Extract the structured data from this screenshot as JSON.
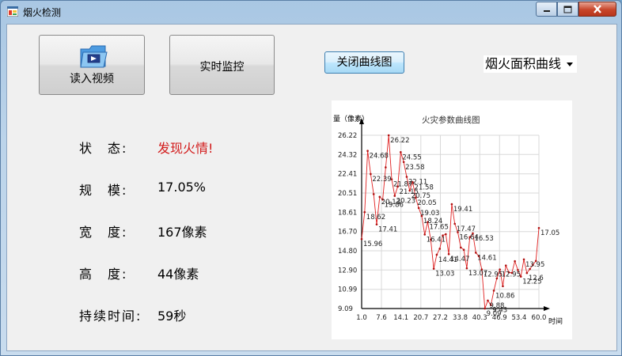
{
  "window": {
    "title": "烟火检测",
    "controls": [
      "minimize",
      "maximize",
      "close"
    ]
  },
  "buttons": {
    "read_video": "读入视频",
    "live_monitor": "实时监控",
    "close_chart": "关闭曲线图"
  },
  "combo": {
    "selected": "烟火面积曲线"
  },
  "info": [
    {
      "label": "状　态:",
      "value": "发现火情!",
      "alert": true
    },
    {
      "label": "规　模:",
      "value": "17.05%"
    },
    {
      "label": "宽　度:",
      "value": "167像素"
    },
    {
      "label": "高　度:",
      "value": "44像素"
    },
    {
      "label": "持续时间:",
      "value": "59秒"
    }
  ],
  "colors": {
    "alert": "#d21a1a",
    "series": "#e02020",
    "grid": "#d8d8d8"
  },
  "chart_data": {
    "type": "line",
    "title": "火灾参数曲线图",
    "ylabel": "量（像素）",
    "xlabel": "时间",
    "y_ticks": [
      9.09,
      10.99,
      12.9,
      14.8,
      16.7,
      18.61,
      20.51,
      22.41,
      24.32,
      26.22
    ],
    "x_ticks": [
      1.0,
      7.6,
      14.1,
      20.7,
      27.2,
      33.8,
      40.3,
      46.9,
      53.4,
      60.0
    ],
    "xlim": [
      1.0,
      60.0
    ],
    "ylim": [
      9.09,
      26.22
    ],
    "grid": true,
    "series": [
      {
        "x": [
          1,
          2,
          3,
          4,
          5,
          6,
          7,
          8,
          9,
          10,
          11,
          12,
          13,
          14,
          15,
          16,
          17,
          18,
          19,
          20,
          21,
          22,
          23,
          24,
          25,
          26,
          27,
          28,
          29,
          30,
          31,
          32,
          33,
          34,
          35,
          36,
          37,
          38,
          39,
          40,
          41,
          42,
          43,
          44,
          45,
          46,
          47,
          48,
          49,
          50,
          51,
          52,
          53,
          54,
          55,
          56,
          57,
          58,
          59,
          60
        ],
        "values": [
          15.96,
          18.62,
          24.68,
          22.39,
          20.4,
          17.41,
          20.13,
          19.86,
          23.05,
          26.22,
          21.87,
          20.23,
          21.15,
          24.55,
          23.58,
          22.11,
          20.75,
          21.58,
          20.05,
          19.03,
          18.24,
          16.41,
          17.65,
          15.9,
          13.03,
          14.41,
          15.0,
          16.31,
          16.44,
          14.47,
          19.41,
          17.47,
          16.64,
          15.12,
          14.9,
          13.07,
          16.15,
          16.53,
          14.61,
          14.27,
          12.95,
          9.09,
          9.88,
          9.43,
          10.86,
          12.07,
          12.95,
          11.3,
          13.34,
          12.67,
          12.61,
          13.77,
          12.9,
          12.25,
          13.95,
          12.6,
          13.0,
          13.4,
          13.8,
          17.05
        ]
      }
    ],
    "data_labels": [
      {
        "x": 1,
        "text": "15.96"
      },
      {
        "x": 2,
        "text": "18.62"
      },
      {
        "x": 3,
        "text": "24.68"
      },
      {
        "x": 4,
        "text": "22.39"
      },
      {
        "x": 6,
        "text": "17.41"
      },
      {
        "x": 7,
        "text": "20.13"
      },
      {
        "x": 8,
        "text": "19.86"
      },
      {
        "x": 10,
        "text": "26.22"
      },
      {
        "x": 11,
        "text": "21.87"
      },
      {
        "x": 12,
        "text": "20.23"
      },
      {
        "x": 13,
        "text": "21.15"
      },
      {
        "x": 14,
        "text": "24.55"
      },
      {
        "x": 15,
        "text": "23.58"
      },
      {
        "x": 16,
        "text": "22.11"
      },
      {
        "x": 17,
        "text": "20.75"
      },
      {
        "x": 18,
        "text": "21.58"
      },
      {
        "x": 19,
        "text": "20.05"
      },
      {
        "x": 20,
        "text": "19.03"
      },
      {
        "x": 21,
        "text": "18.24"
      },
      {
        "x": 22,
        "text": "16.41"
      },
      {
        "x": 23,
        "text": "17.65"
      },
      {
        "x": 25,
        "text": "13.03"
      },
      {
        "x": 26,
        "text": "14.41"
      },
      {
        "x": 30,
        "text": "14.47"
      },
      {
        "x": 31,
        "text": "19.41"
      },
      {
        "x": 32,
        "text": "17.47"
      },
      {
        "x": 33,
        "text": "16.64"
      },
      {
        "x": 36,
        "text": "13.07"
      },
      {
        "x": 38,
        "text": "16.53"
      },
      {
        "x": 39,
        "text": "14.61"
      },
      {
        "x": 41,
        "text": "12.95"
      },
      {
        "x": 42,
        "text": "9.09"
      },
      {
        "x": 43,
        "text": "9.88"
      },
      {
        "x": 44,
        "text": "9.43"
      },
      {
        "x": 45,
        "text": "10.86"
      },
      {
        "x": 47,
        "text": "12.95"
      },
      {
        "x": 54,
        "text": "12.25"
      },
      {
        "x": 55,
        "text": "13.95"
      },
      {
        "x": 56,
        "text": "12.6"
      },
      {
        "x": 60,
        "text": "17.05"
      }
    ]
  }
}
